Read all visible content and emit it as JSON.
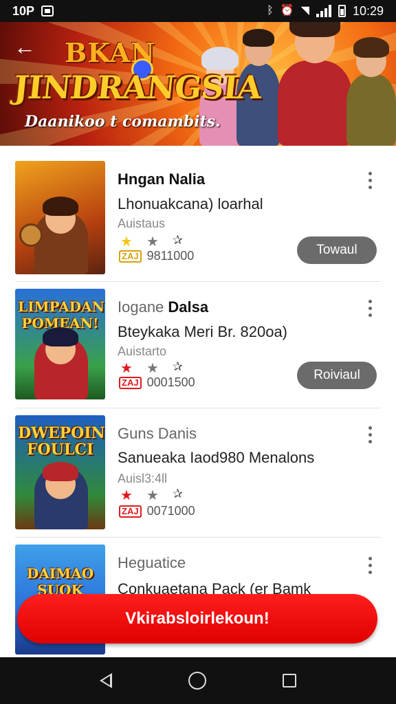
{
  "status_bar": {
    "left_text": "10P",
    "time": "10:29"
  },
  "hero": {
    "title_top": "BKAN",
    "title_main": "JINDRANGSIA",
    "tagline": "Daanikoo t comambits."
  },
  "items": [
    {
      "name": "Hngan Nalia",
      "name_prefix": "",
      "description": "Lhonuakcana) loarhal",
      "subtitle": "Auistaus",
      "count": "9811000",
      "badge": "ZAJ",
      "star_style": "gold",
      "button_label": "Towaul",
      "thumb_text": ""
    },
    {
      "name": "Dalsa",
      "name_prefix": "Iogane",
      "description": "Bteykaka Meri Br. 820oa)",
      "subtitle": "Auistarto",
      "count": "0001500",
      "badge": "ZAJ",
      "star_style": "red",
      "button_label": "Roiviaul",
      "thumb_text": "LIMPADAN POMEAN!"
    },
    {
      "name": "",
      "name_prefix": "Guns Danis",
      "description": "Sanueaka Iaod980 Menalons",
      "subtitle": "Auisl3:4ll",
      "count": "0071000",
      "badge": "ZAJ",
      "star_style": "red",
      "button_label": "",
      "thumb_text": "DWEPOIN FOULCI"
    },
    {
      "name": "",
      "name_prefix": "Heguatice",
      "description": "Conkuaetana Pack (er Bamk",
      "subtitle": "",
      "count": "",
      "badge": "",
      "star_style": "none",
      "button_label": "",
      "thumb_text": "DAIMAO SUOK"
    }
  ],
  "cta": {
    "label": "Vkirabsloirlekoun!"
  },
  "colors": {
    "accent_red": "#e60000",
    "pill_gray": "#6b6b6b",
    "star_gold": "#f4c518",
    "star_red": "#e0191e"
  },
  "icons": [
    "back-arrow-icon",
    "more-vert-icon",
    "star-icon",
    "nav-back-icon",
    "nav-home-icon",
    "nav-recents-icon"
  ]
}
